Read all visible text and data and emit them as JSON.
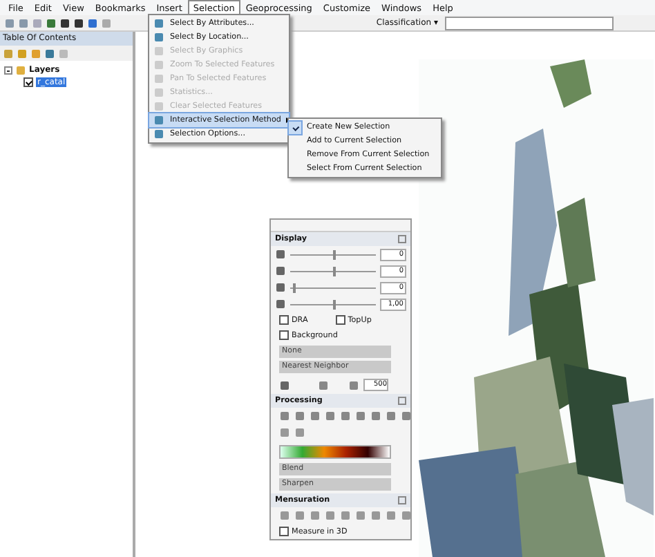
{
  "menu_bar": [
    {
      "label": "File",
      "selected": false
    },
    {
      "label": "Edit",
      "selected": false
    },
    {
      "label": "View",
      "selected": false
    },
    {
      "label": "Bookmarks",
      "selected": false
    },
    {
      "label": "Insert",
      "selected": false
    },
    {
      "label": "Selection",
      "selected": true
    },
    {
      "label": "Geoprocessing",
      "selected": false
    },
    {
      "label": "Customize",
      "selected": false
    },
    {
      "label": "Windows",
      "selected": false
    },
    {
      "label": "Help",
      "selected": false
    }
  ],
  "toolbar": {
    "classification": "Classification ▾"
  },
  "table_of_contents": {
    "title": "Table Of Contents",
    "layers": [
      {
        "label": "Layers",
        "expanded": true,
        "children": [
          {
            "label": "r_catal",
            "checked": true,
            "selected": true
          }
        ]
      }
    ]
  },
  "selection_menu": [
    {
      "label": "Select By Attributes...",
      "disabled": false,
      "submenu": false,
      "selected": false
    },
    {
      "label": "Select By Location...",
      "disabled": false,
      "submenu": false,
      "selected": false
    },
    {
      "label": "Select By Graphics",
      "disabled": true,
      "submenu": false,
      "selected": false
    },
    {
      "label": "Zoom To Selected Features",
      "disabled": true,
      "submenu": false,
      "selected": false
    },
    {
      "label": "Pan To Selected Features",
      "disabled": true,
      "submenu": false,
      "selected": false
    },
    {
      "label": "Statistics...",
      "disabled": true,
      "submenu": false,
      "selected": false
    },
    {
      "label": "Clear Selected Features",
      "disabled": true,
      "submenu": false,
      "selected": false
    },
    {
      "label": "Interactive Selection Method",
      "disabled": false,
      "submenu": true,
      "selected": true
    },
    {
      "label": "Selection Options...",
      "disabled": false,
      "submenu": false,
      "selected": false
    }
  ],
  "interactive_selection_submenu": [
    {
      "label": "Create New Selection",
      "checked": true
    },
    {
      "label": "Add to Current Selection",
      "checked": false
    },
    {
      "label": "Remove From Current Selection",
      "checked": false
    },
    {
      "label": "Select From Current Selection",
      "checked": false
    }
  ],
  "image_analysis": {
    "display": {
      "title": "Display",
      "sliders": [
        {
          "level": 0.5,
          "value": "0"
        },
        {
          "level": 0.5,
          "value": "0"
        },
        {
          "level": 0.03,
          "value": "0"
        },
        {
          "level": 0.5,
          "value": "1,00"
        }
      ],
      "checkboxes": [
        {
          "label": "DRA",
          "checked": false
        },
        {
          "label": "TopUp",
          "checked": false
        },
        {
          "label": "Background",
          "checked": false
        }
      ],
      "dropdowns": [
        "None",
        "Nearest Neighbor"
      ],
      "spinner": "500"
    },
    "processing": {
      "title": "Processing",
      "dropdowns": [
        "Blend",
        "Sharpen"
      ]
    },
    "mensuration": {
      "title": "Mensuration",
      "checkbox": {
        "label": "Measure in 3D",
        "checked": false
      }
    }
  }
}
